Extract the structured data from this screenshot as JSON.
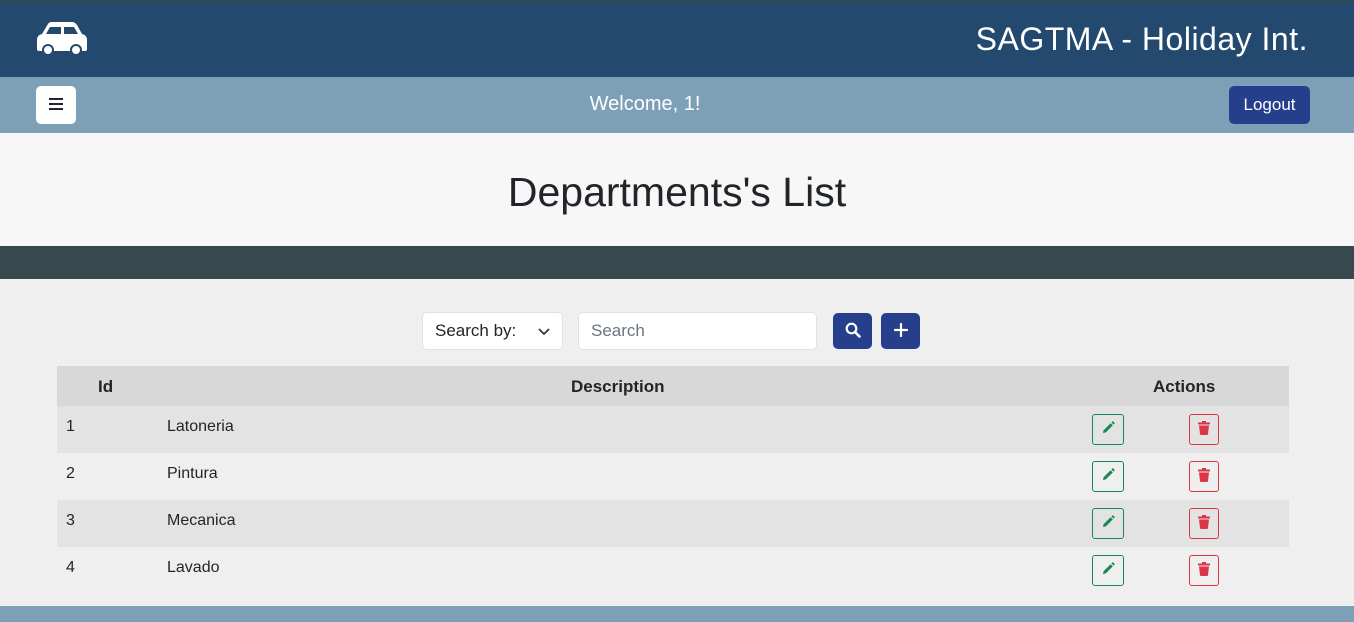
{
  "header": {
    "brand": "SAGTMA - Holiday Int.",
    "logo_icon": "car-icon"
  },
  "navbar": {
    "menu_icon": "hamburger-icon",
    "welcome": "Welcome, 1!",
    "logout_label": "Logout"
  },
  "page": {
    "title": "Departments's List"
  },
  "toolbar": {
    "search_by_label": "Search by:",
    "search_placeholder": "Search",
    "search_icon": "search-icon",
    "add_icon": "plus-icon"
  },
  "table": {
    "columns": {
      "id": "Id",
      "description": "Description",
      "actions": "Actions"
    },
    "rows": [
      {
        "id": "1",
        "description": "Latoneria"
      },
      {
        "id": "2",
        "description": "Pintura"
      },
      {
        "id": "3",
        "description": "Mecanica"
      },
      {
        "id": "4",
        "description": "Lavado"
      }
    ]
  },
  "colors": {
    "header_bg": "#23496f",
    "navbar_bg": "#7ea0b7",
    "primary_button": "#253f8c",
    "edit_green": "#198754",
    "delete_red": "#dc3545"
  }
}
